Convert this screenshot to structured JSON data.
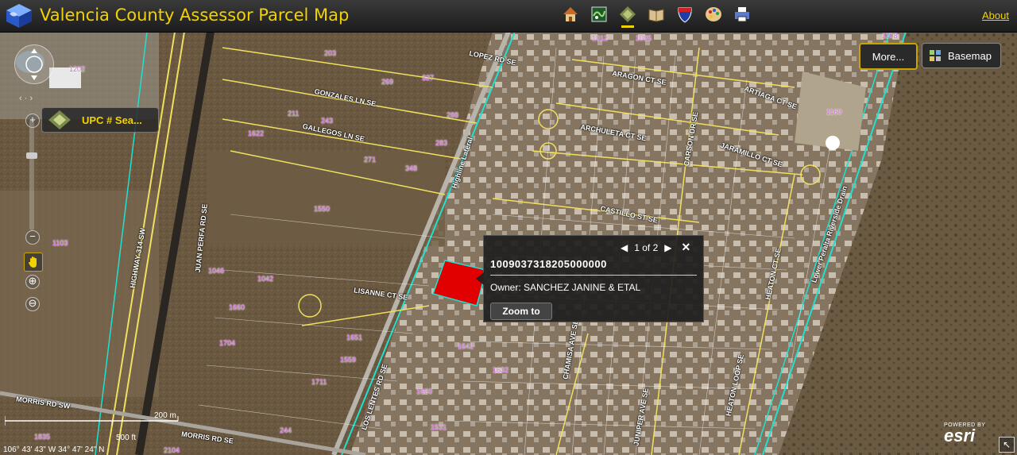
{
  "app": {
    "title": "Valencia County Assessor Parcel Map",
    "about_label": "About"
  },
  "toolbar": [
    {
      "name": "home-icon",
      "active": false
    },
    {
      "name": "map-layers-icon",
      "active": false
    },
    {
      "name": "parcel-search-icon",
      "active": true
    },
    {
      "name": "book-icon",
      "active": false
    },
    {
      "name": "interstate-shield-icon",
      "active": false
    },
    {
      "name": "palette-icon",
      "active": false
    },
    {
      "name": "printer-icon",
      "active": false
    }
  ],
  "map_controls": {
    "upc_search_label": "UPC # Sea...",
    "more_label": "More...",
    "basemap_label": "Basemap"
  },
  "popup": {
    "pager": "1 of 2",
    "parcel_id": "1009037318205000000",
    "owner": "Owner: SANCHEZ JANINE & ETAL",
    "zoom_label": "Zoom to"
  },
  "scale": {
    "metric": "200 m",
    "imperial": "500 ft"
  },
  "coordinates": "106° 43' 43\" W 34° 47' 24\" N",
  "attribution": {
    "powered": "POWERED BY",
    "brand": "esri"
  },
  "streets": [
    "LOPEZ RD SE",
    "GONZALES LN SE",
    "GALLEGOS LN SE",
    "ARAGON CT SE",
    "ARTIAGA CT SE",
    "ARCHULETA CT SE",
    "JARAMILLO CT SE",
    "CARSON DR SE",
    "CASTILLO ST SE",
    "LISANNE CT SE",
    "LOS LENTES RD SE",
    "JUAN PERFA RD SE",
    "HIGHWAY 314 SW",
    "MORRIS RD SW",
    "MORRIS RD SE",
    "CHAMISA AVE SE",
    "JUNIPER AVE SE",
    "HEATON LOOP SE",
    "HEATON CT SE",
    "Highline Lateral",
    "Lower Peralta Riverside Drain"
  ],
  "parcel_numbers": [
    "1202",
    "1103",
    "1550",
    "1622",
    "1046",
    "1042",
    "1660",
    "1704",
    "1642",
    "1632",
    "1660",
    "1711",
    "1531",
    "1559",
    "1651",
    "1835",
    "2104",
    "244",
    "203",
    "211",
    "243",
    "269",
    "271",
    "348",
    "283",
    "288",
    "327",
    "1160",
    "1108",
    "1012",
    "1085"
  ]
}
